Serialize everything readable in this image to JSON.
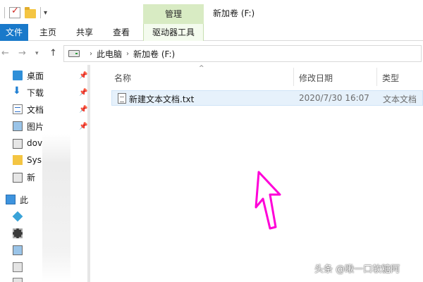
{
  "window": {
    "title": "新加卷 (F:)"
  },
  "context_tab": {
    "group_label": "管理",
    "tab_label": "驱动器工具",
    "color": "#d8ebc3"
  },
  "ribbon": {
    "file_label": "文件",
    "home_label": "主页",
    "share_label": "共享",
    "view_label": "查看",
    "file_color": "#1979ca"
  },
  "address": {
    "crumbs": [
      "此电脑",
      "新加卷 (F:)"
    ]
  },
  "nav_pane": {
    "items": [
      {
        "label": "桌面",
        "icon": "desktop-icon",
        "pinned": true
      },
      {
        "label": "下载",
        "icon": "download-icon",
        "pinned": true
      },
      {
        "label": "文档",
        "icon": "document-icon",
        "pinned": true
      },
      {
        "label": "图片",
        "icon": "picture-icon",
        "pinned": true
      },
      {
        "label": "dov",
        "icon": "drive-icon",
        "pinned": false
      },
      {
        "label": "Sys",
        "icon": "folder-icon",
        "pinned": false
      },
      {
        "label": "新",
        "icon": "drive-icon",
        "pinned": false
      },
      {
        "label": "此",
        "icon": "this-pc-icon",
        "pinned": false
      },
      {
        "label": "",
        "icon": "3d-objects-icon",
        "pinned": false
      },
      {
        "label": "",
        "icon": "video-icon",
        "pinned": false
      },
      {
        "label": "",
        "icon": "pictures-icon",
        "pinned": false
      },
      {
        "label": "",
        "icon": "documents-icon",
        "pinned": false
      }
    ]
  },
  "columns": {
    "name": "名称",
    "date": "修改日期",
    "type": "类型"
  },
  "files": [
    {
      "name": "新建文本文档.txt",
      "modified": "2020/7/30 16:07",
      "type": "文本文档"
    }
  ],
  "annotation": {
    "arrow_color": "#ff00d8"
  },
  "watermark": {
    "text": "头条 @瞅一口软糖阿"
  }
}
